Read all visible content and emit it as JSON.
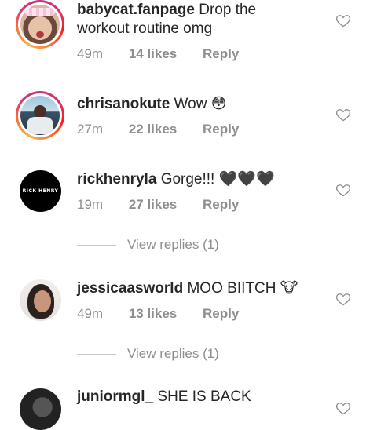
{
  "comments": [
    {
      "username": "babycat.fanpage",
      "text_line1": "Drop the",
      "text_line2": "workout routine omg",
      "time": "49m",
      "likes": "14 likes",
      "reply": "Reply",
      "avatar": "babycat-avatar",
      "story_ring": true
    },
    {
      "username": "chrisanokute",
      "text": "Wow",
      "emoji": "😳",
      "time": "27m",
      "likes": "22 likes",
      "reply": "Reply",
      "avatar": "chris-avatar",
      "story_ring": true
    },
    {
      "username": "rickhenryla",
      "text": "Gorge!!!",
      "emoji": "🖤🖤🖤",
      "time": "19m",
      "likes": "27 likes",
      "reply": "Reply",
      "avatar_text": "RICK HENRY",
      "story_ring": false,
      "view_replies": "View replies (1)"
    },
    {
      "username": "jessicaasworld",
      "text": "MOO BIITCH",
      "emoji": "🐮",
      "time": "49m",
      "likes": "13 likes",
      "reply": "Reply",
      "avatar": "jessica-avatar",
      "story_ring": false,
      "view_replies": "View replies (1)"
    },
    {
      "username": "juniormgl_",
      "text": "SHE IS BACK",
      "avatar": "junior-avatar",
      "story_ring": false
    }
  ],
  "icons": {
    "like": "heart-outline-icon"
  },
  "colors": {
    "text": "#262626",
    "secondary": "#8e8e8e",
    "ring_start": "#c13584",
    "ring_end": "#fcaf45"
  }
}
